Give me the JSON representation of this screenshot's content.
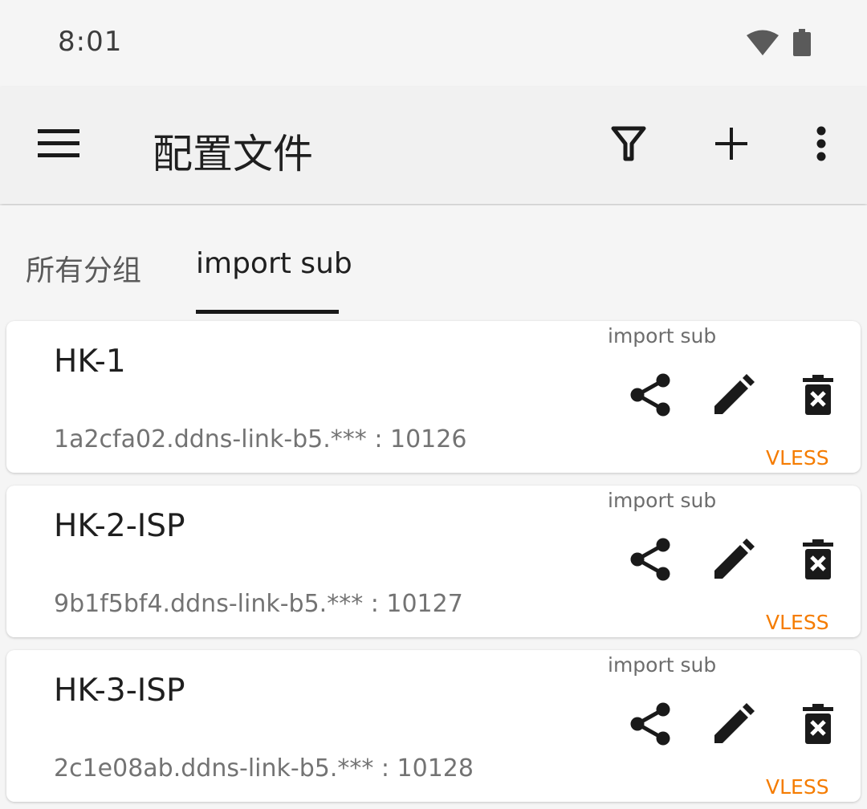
{
  "status_bar": {
    "time": "8:01",
    "icons": [
      "wifi-icon",
      "battery-icon"
    ]
  },
  "toolbar": {
    "title": "配置文件",
    "icons": [
      "menu-icon",
      "filter-icon",
      "add-icon",
      "more-vert-icon"
    ]
  },
  "tabs": [
    {
      "label": "所有分组",
      "selected": false
    },
    {
      "label": "import sub",
      "selected": true
    }
  ],
  "profiles": [
    {
      "name": "HK-1",
      "address": "1a2cfa02.ddns-link-b5.*** : 10126",
      "group": "import sub",
      "type": "VLESS"
    },
    {
      "name": "HK-2-ISP",
      "address": "9b1f5bf4.ddns-link-b5.*** : 10127",
      "group": "import sub",
      "type": "VLESS"
    },
    {
      "name": "HK-3-ISP",
      "address": "2c1e08ab.ddns-link-b5.*** : 10128",
      "group": "import sub",
      "type": "VLESS"
    }
  ],
  "colors": {
    "accent_type": "#f57c00",
    "toolbar_bg": "#f1f1f1",
    "background": "#f5f5f5"
  }
}
